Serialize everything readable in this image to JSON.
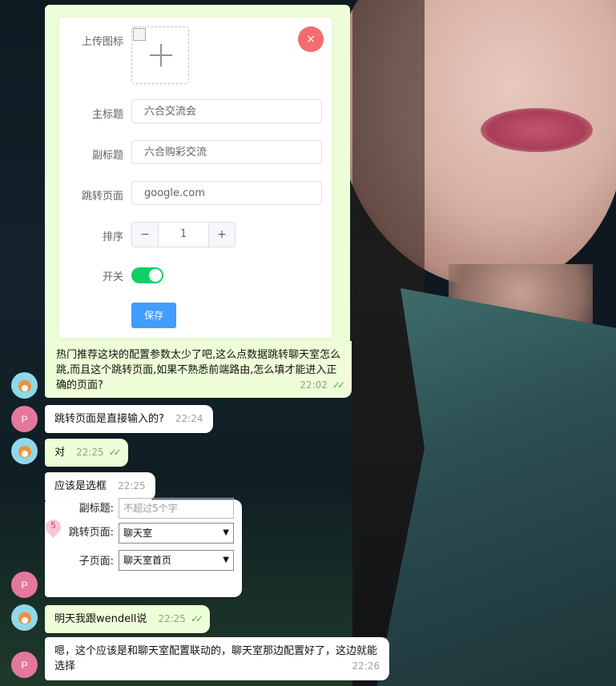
{
  "form": {
    "upload_label": "上传图标",
    "close_symbol": "×",
    "title_label": "主标题",
    "title_value": "六合交流会",
    "subtitle_label": "副标题",
    "subtitle_value": "六合购彩交流",
    "jump_label": "跳转页面",
    "jump_value": "google.com",
    "sort_label": "排序",
    "sort_value": "1",
    "minus": "−",
    "plus": "+",
    "switch_label": "开关",
    "switch_on": true,
    "save_label": "保存"
  },
  "messages": [
    {
      "text": "热门推荐这块的配置参数太少了吧,这么点数据跳转聊天室怎么跳,而且这个跳转页面,如果不熟悉前端路由,怎么填才能进入正确的页面?",
      "time": "22:02",
      "direction": "out",
      "read": true
    },
    {
      "text": "跳转页面是直接输入的?",
      "time": "22:24",
      "direction": "in"
    },
    {
      "text": "对",
      "time": "22:25",
      "direction": "out",
      "read": true
    },
    {
      "text": "应该是选框",
      "time": "22:25",
      "direction": "in"
    },
    {
      "text": "明天我跟wendell说",
      "time": "22:25",
      "direction": "out",
      "read": true
    },
    {
      "text": "嗯，这个应该是和聊天室配置联动的，聊天室那边配置好了，这边就能选择",
      "time": "22:26",
      "direction": "in"
    }
  ],
  "embedded_form": {
    "subtitle_label": "副标题:",
    "subtitle_placeholder": "不超过5个字",
    "jump_label": "跳转页面:",
    "jump_value": "聊天室",
    "child_label": "子页面:",
    "child_value": "聊天室首页",
    "pin_number": "5"
  },
  "avatars": {
    "other_initial": "P"
  },
  "colors": {
    "outgoing_bubble": "#eefed8",
    "switch_on": "#13ce66",
    "save_button": "#409eff",
    "close_button": "#f56c6c",
    "avatar_p": "#e5779e",
    "avatar_dog": "#8fd8ea"
  },
  "icons": {
    "read_receipt": "double-check-icon",
    "upload": "plus-icon",
    "broken_image": "broken-image-icon"
  }
}
